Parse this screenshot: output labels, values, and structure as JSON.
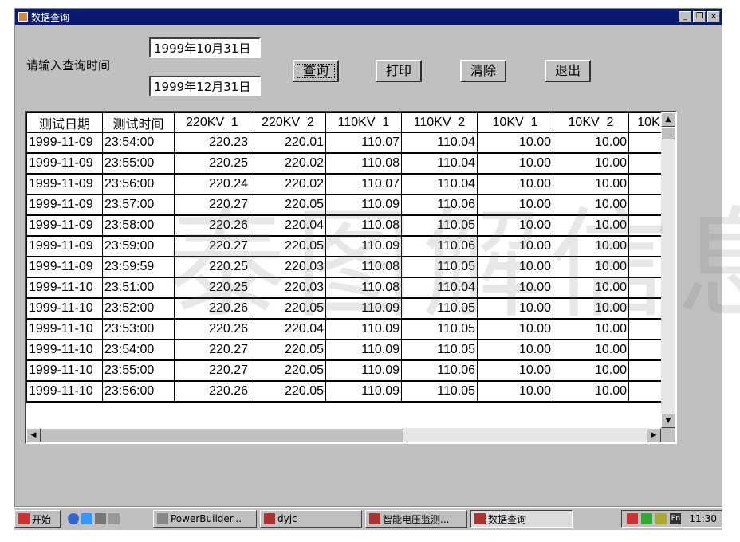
{
  "window": {
    "title": "数据查询",
    "btn_min": "_",
    "btn_restore": "❐",
    "btn_close": "×"
  },
  "query": {
    "prompt": "请输入查询时间",
    "start_date": "1999年10月31日",
    "end_date": "1999年12月31日"
  },
  "buttons": {
    "query": "查询",
    "print": "打印",
    "clear": "清除",
    "exit": "退出"
  },
  "table": {
    "columns": [
      "测试日期",
      "测试时间",
      "220KV_1",
      "220KV_2",
      "110KV_1",
      "110KV_2",
      "10KV_1",
      "10KV_2",
      "10K"
    ],
    "rows": [
      [
        "1999-11-09",
        "23:54:00",
        "220.23",
        "220.01",
        "110.07",
        "110.04",
        "10.00",
        "10.00",
        ""
      ],
      [
        "1999-11-09",
        "23:55:00",
        "220.25",
        "220.02",
        "110.08",
        "110.04",
        "10.00",
        "10.00",
        ""
      ],
      [
        "1999-11-09",
        "23:56:00",
        "220.24",
        "220.02",
        "110.07",
        "110.04",
        "10.00",
        "10.00",
        ""
      ],
      [
        "1999-11-09",
        "23:57:00",
        "220.27",
        "220.05",
        "110.09",
        "110.06",
        "10.00",
        "10.00",
        ""
      ],
      [
        "1999-11-09",
        "23:58:00",
        "220.26",
        "220.04",
        "110.08",
        "110.05",
        "10.00",
        "10.00",
        ""
      ],
      [
        "1999-11-09",
        "23:59:00",
        "220.27",
        "220.05",
        "110.09",
        "110.06",
        "10.00",
        "10.00",
        ""
      ],
      [
        "1999-11-09",
        "23:59:59",
        "220.25",
        "220.03",
        "110.08",
        "110.05",
        "10.00",
        "10.00",
        ""
      ],
      [
        "1999-11-10",
        "23:51:00",
        "220.25",
        "220.03",
        "110.08",
        "110.04",
        "10.00",
        "10.00",
        ""
      ],
      [
        "1999-11-10",
        "23:52:00",
        "220.26",
        "220.05",
        "110.09",
        "110.05",
        "10.00",
        "10.00",
        ""
      ],
      [
        "1999-11-10",
        "23:53:00",
        "220.26",
        "220.04",
        "110.09",
        "110.05",
        "10.00",
        "10.00",
        ""
      ],
      [
        "1999-11-10",
        "23:54:00",
        "220.27",
        "220.05",
        "110.09",
        "110.05",
        "10.00",
        "10.00",
        ""
      ],
      [
        "1999-11-10",
        "23:55:00",
        "220.27",
        "220.05",
        "110.09",
        "110.06",
        "10.00",
        "10.00",
        ""
      ],
      [
        "1999-11-10",
        "23:56:00",
        "220.26",
        "220.05",
        "110.09",
        "110.05",
        "10.00",
        "10.00",
        ""
      ]
    ]
  },
  "watermark": "泰图解信息",
  "taskbar": {
    "start": "开始",
    "items": [
      {
        "label": "PowerBuilder...",
        "icon": "powerbuilder-icon"
      },
      {
        "label": "dyjc",
        "icon": "app-icon"
      },
      {
        "label": "智能电压监测...",
        "icon": "app-icon"
      },
      {
        "label": "数据查询",
        "icon": "app-icon"
      }
    ],
    "tray_lang": "En",
    "clock": "11:30"
  },
  "colors": {
    "titlebar": "#0a1a6e",
    "face": "#c0c0c0"
  }
}
